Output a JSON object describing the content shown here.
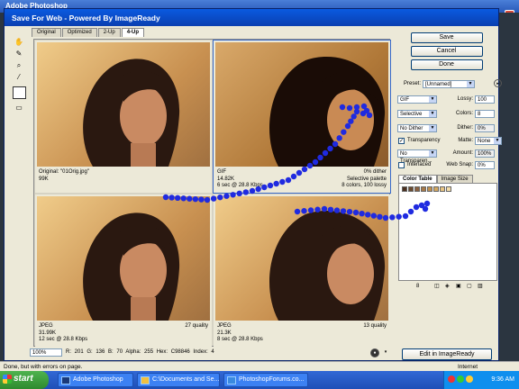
{
  "app_title": "Adobe Photoshop",
  "dialog": {
    "title": "Save For Web - Powered By ImageReady",
    "tabs": [
      "Original",
      "Optimized",
      "2-Up",
      "4-Up"
    ],
    "active_tab": "4-Up"
  },
  "panes": [
    {
      "info_left": [
        "Original: \"01Orig.jpg\"",
        "99K"
      ],
      "info_right": []
    },
    {
      "info_left": [
        "GIF",
        "14.82K",
        "6 sec @ 28.8 Kbps"
      ],
      "info_right": [
        "0% dither",
        "Selective palette",
        "8 colors, 100 lossy"
      ]
    },
    {
      "info_left": [
        "JPEG",
        "31.99K",
        "12 sec @ 28.8 Kbps"
      ],
      "info_right": [
        "27 quality"
      ]
    },
    {
      "info_left": [
        "JPEG",
        "21.3K",
        "8 sec @ 28.8 Kbps"
      ],
      "info_right": [
        "13 quality"
      ]
    }
  ],
  "buttons": {
    "save": "Save",
    "cancel": "Cancel",
    "done": "Done",
    "edit": "Edit in ImageReady"
  },
  "settings": {
    "preset_label": "Preset:",
    "preset_value": "[Unnamed]",
    "format": "GIF",
    "lossy_label": "Lossy:",
    "lossy_value": "100",
    "palette": "Selective",
    "colors_label": "Colors:",
    "colors_value": "8",
    "dither_method": "No Dither",
    "dither_label": "Dither:",
    "dither_value": "0%",
    "transparency_label": "Transparency",
    "matte_label": "Matte:",
    "matte_value": "None",
    "trans_dither": "No Transparen...",
    "amount_label": "Amount:",
    "amount_value": "100%",
    "interlaced_label": "Interlaced",
    "websnap_label": "Web Snap:",
    "websnap_value": "0%"
  },
  "color_table": {
    "tabs": [
      "Color Table",
      "Image Size"
    ],
    "count": "8",
    "swatches": [
      "#4a3020",
      "#6a4a30",
      "#8a6040",
      "#a67848",
      "#c0904f",
      "#d4a860",
      "#e8c482",
      "#f4dca8"
    ]
  },
  "readout": {
    "zoom": "100%",
    "text": "R: 201  G: 136  B: 70  Alpha: 255  Hex: C98846  Index: 4"
  },
  "status_bar": {
    "text": "Done, but with errors on page.",
    "zone": "Internet"
  },
  "taskbar": {
    "start": "start",
    "items": [
      "Adobe Photoshop",
      "C:\\Documents and Se...",
      "PhotoshopForums.co..."
    ],
    "time": "9:36 AM"
  },
  "colors": {
    "scribble": "#1f2ae0",
    "title_blue": "#0a4fd0"
  }
}
